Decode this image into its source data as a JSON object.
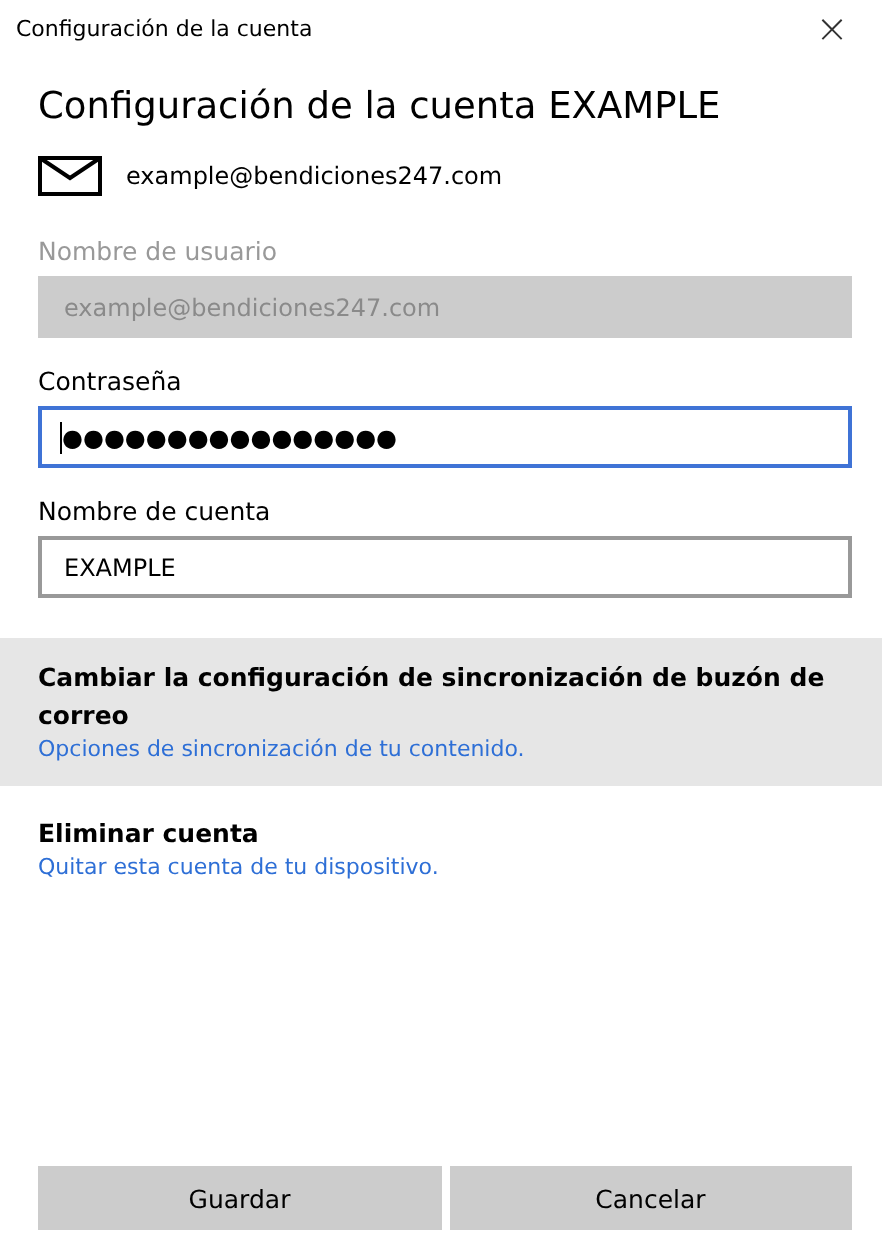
{
  "window": {
    "title": "Configuración de la cuenta",
    "close": "×"
  },
  "heading": "Configuración de la cuenta EXAMPLE",
  "email": "example@bendiciones247.com",
  "fields": [
    {
      "label": "Nombre de usuario",
      "value": "example@bendiciones247.com",
      "disabled": true,
      "focused": false
    },
    {
      "label": "Contraseña",
      "value": "●●●●●●●●●●●●●●●●",
      "disabled": false,
      "focused": true
    },
    {
      "label": "Nombre de cuenta",
      "value": "EXAMPLE",
      "disabled": false,
      "focused": false
    }
  ],
  "actions": [
    {
      "title": "Cambiar la configuración de sincronización de buzón de correo",
      "link": "Opciones de sincronización de tu contenido.",
      "highlighted": true
    },
    {
      "title": "Eliminar cuenta",
      "link": "Quitar esta cuenta de tu dispositivo.",
      "highlighted": false
    }
  ],
  "buttons": [
    "Guardar",
    "Cancelar"
  ]
}
